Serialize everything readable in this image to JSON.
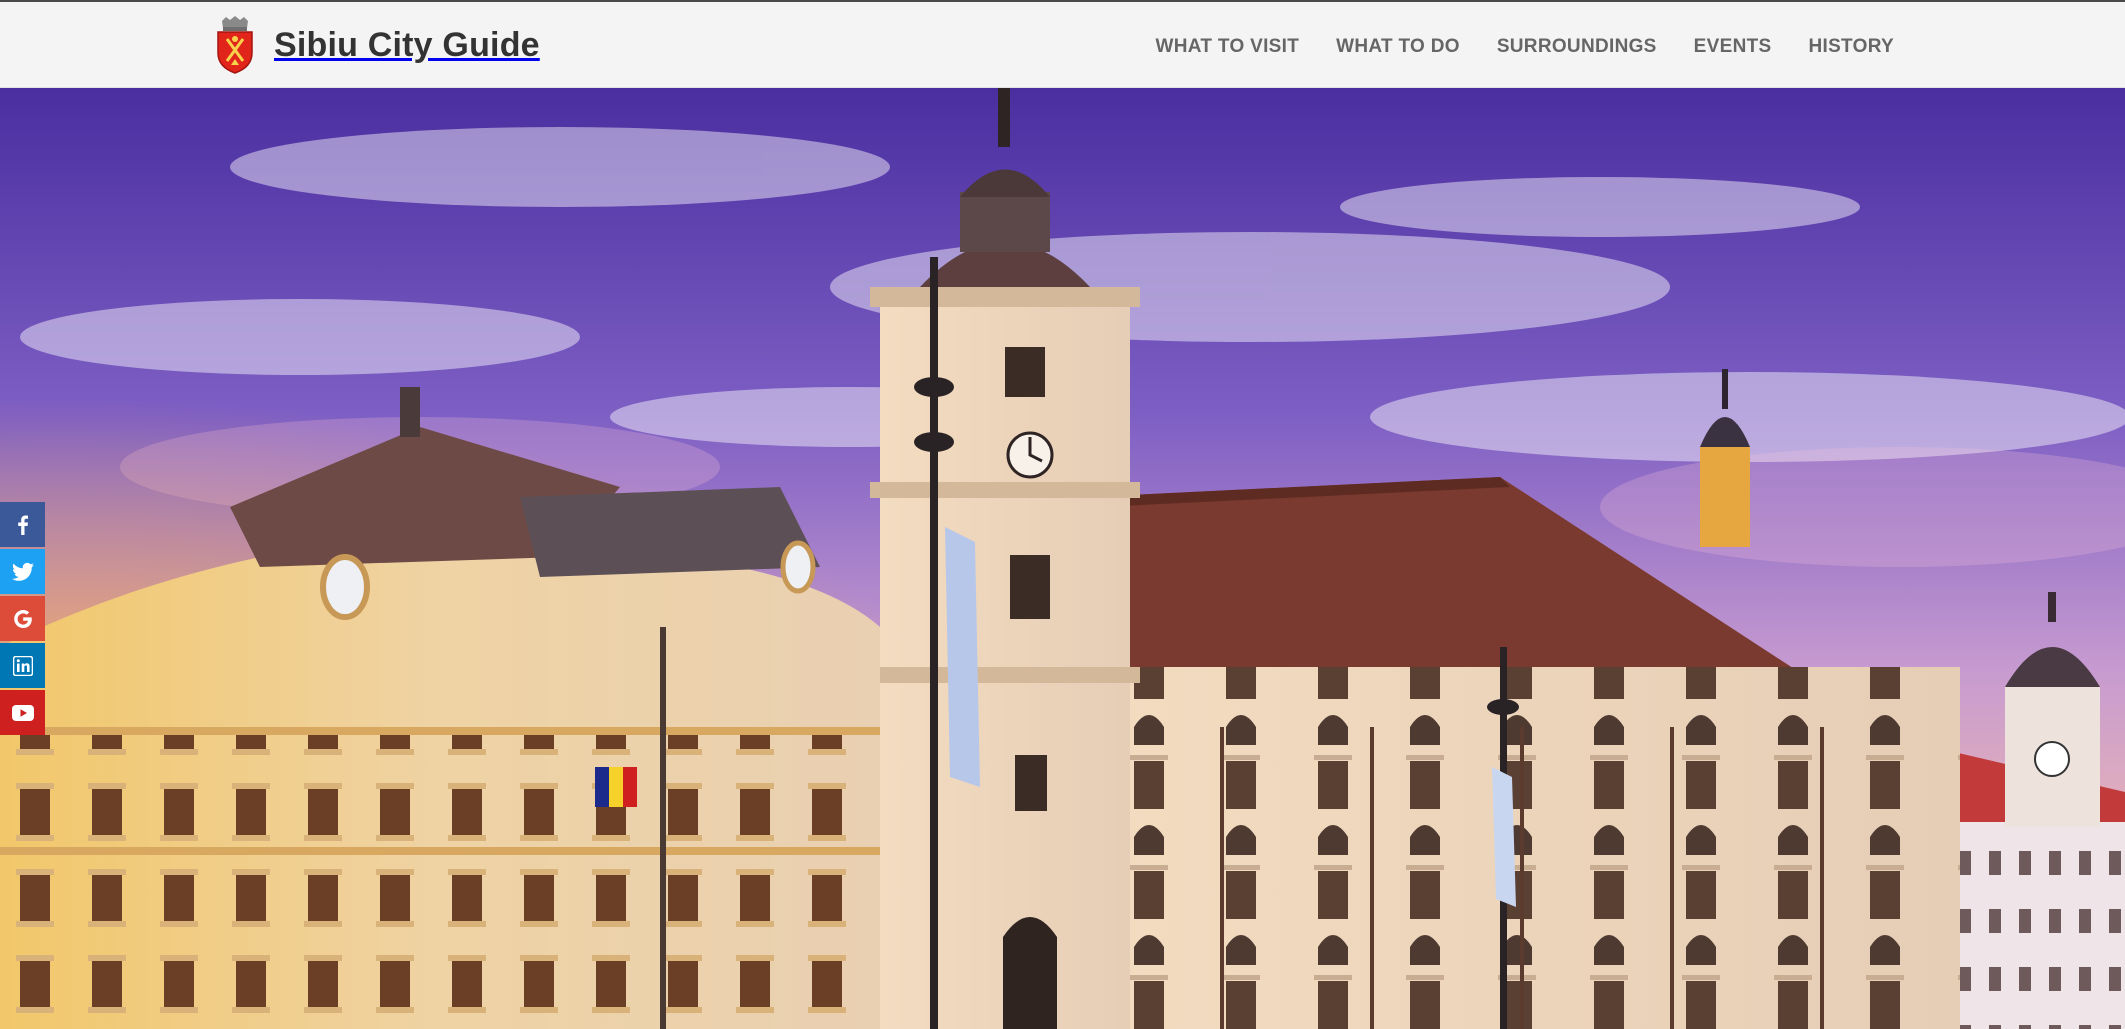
{
  "header": {
    "logo_icon": "sibiu-coat-of-arms-icon",
    "title": "Sibiu City Guide"
  },
  "nav": {
    "items": [
      {
        "label": "WHAT TO VISIT"
      },
      {
        "label": "WHAT TO DO"
      },
      {
        "label": "SURROUNDINGS"
      },
      {
        "label": "EVENTS"
      },
      {
        "label": "HISTORY"
      }
    ]
  },
  "hero": {
    "image": "Sibiu Grand Square panorama at sunset with church clock tower"
  },
  "social": {
    "items": [
      {
        "icon": "facebook-icon",
        "color": "#3b5998"
      },
      {
        "icon": "twitter-icon",
        "color": "#1da1f2"
      },
      {
        "icon": "google-icon",
        "color": "#dd4b39"
      },
      {
        "icon": "linkedin-icon",
        "color": "#0077b5"
      },
      {
        "icon": "youtube-icon",
        "color": "#cd201f"
      }
    ]
  },
  "colors": {
    "header_bg": "#f4f4f4",
    "title_text": "#333333",
    "nav_text": "#666666",
    "sky_top": "#4a2ea0",
    "sky_glow": "#f0b888"
  }
}
